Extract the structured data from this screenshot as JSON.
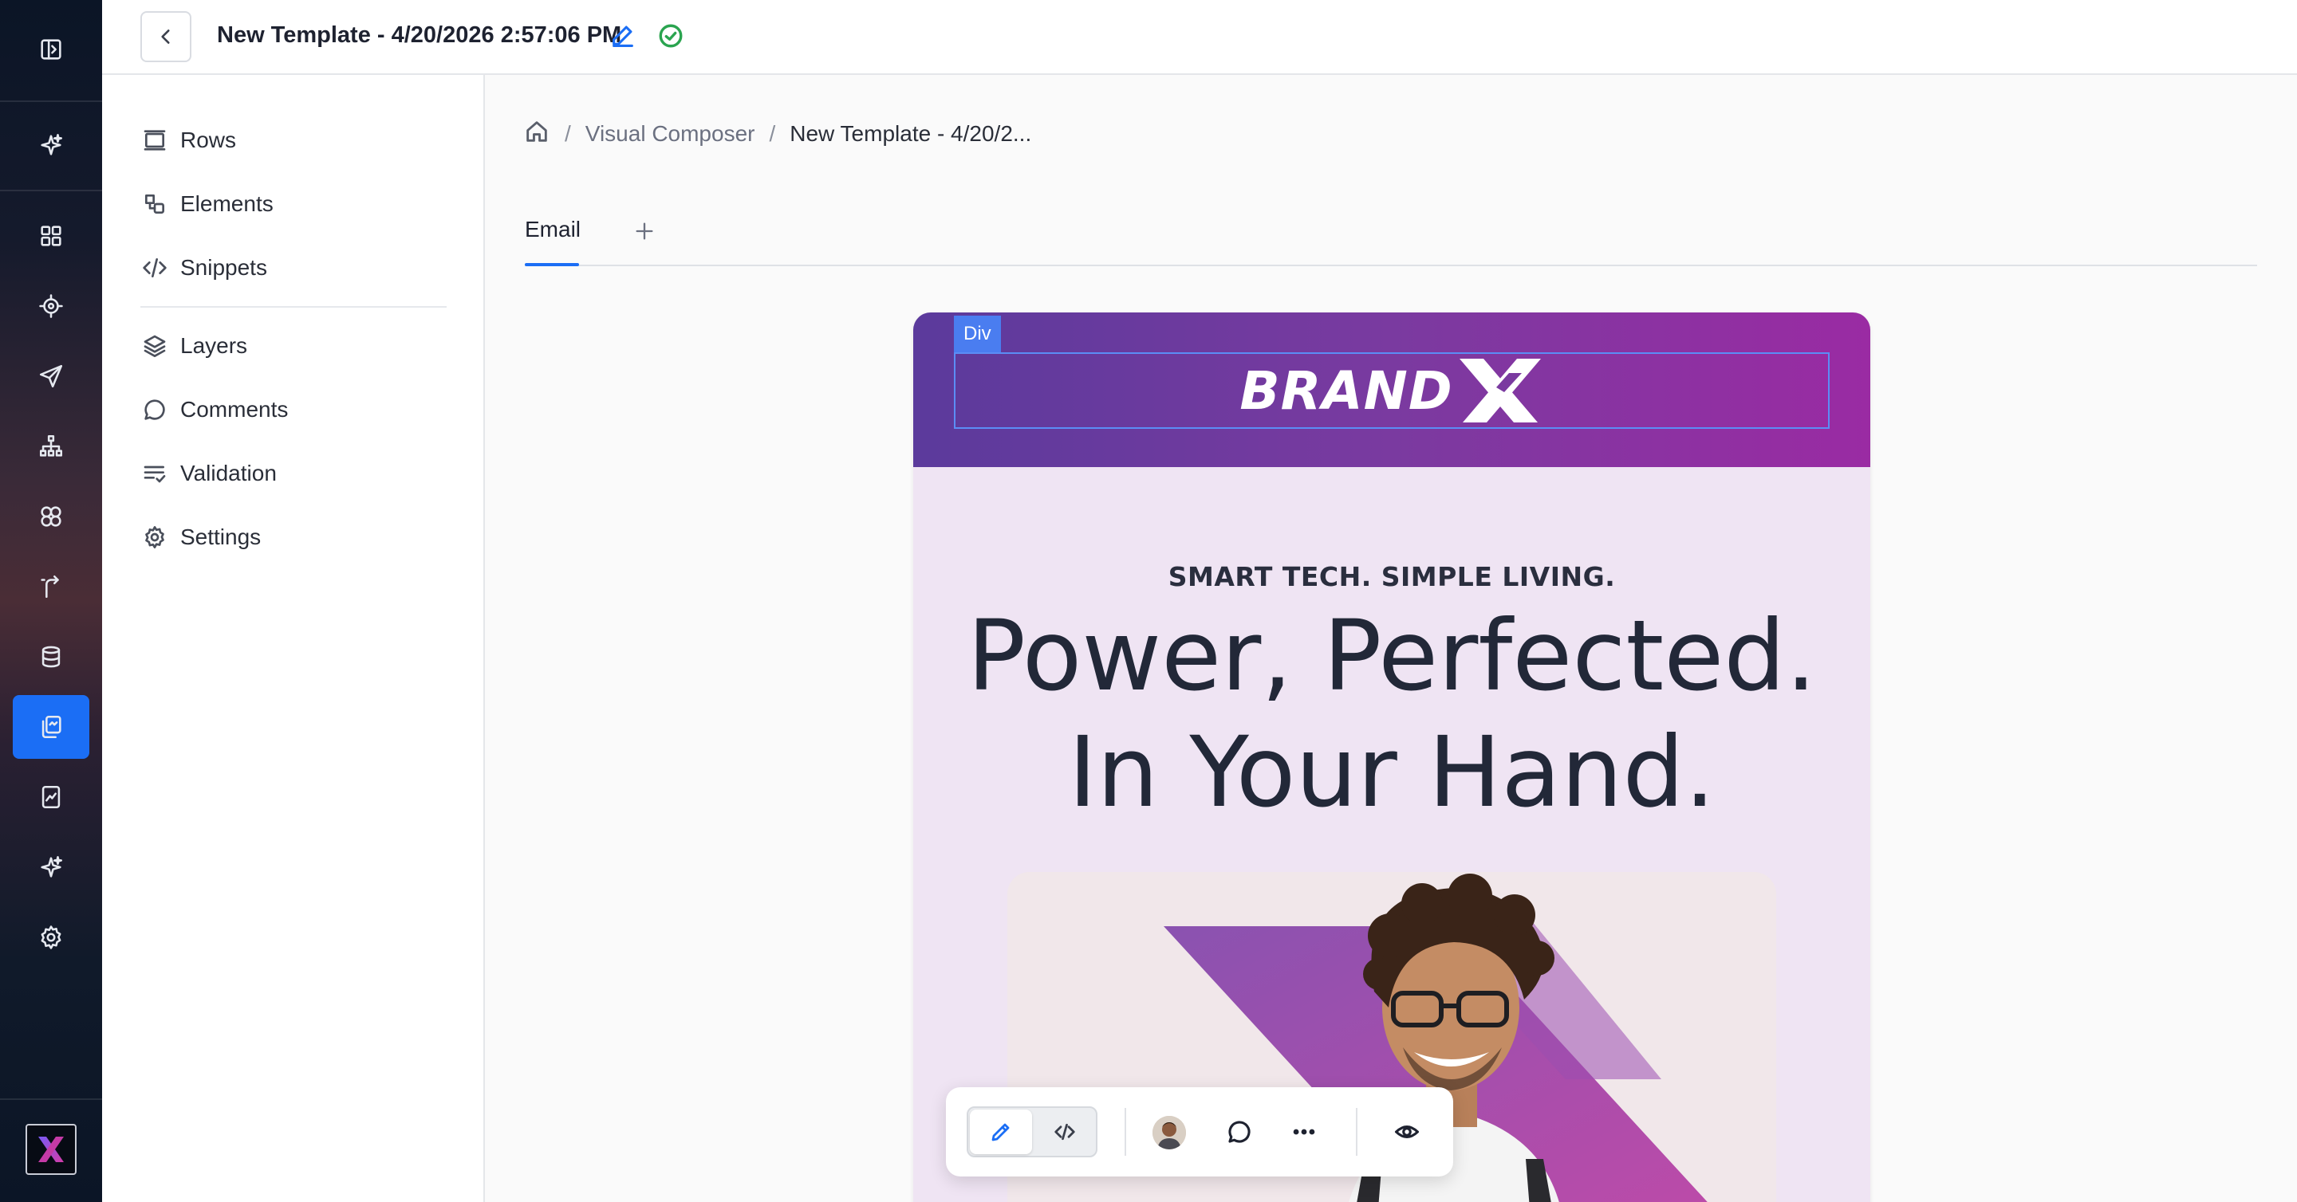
{
  "topbar": {
    "title": "New Template - 4/20/2026 2:57:06 PM"
  },
  "panel": {
    "items": [
      {
        "label": "Rows",
        "icon": "rows-icon"
      },
      {
        "label": "Elements",
        "icon": "elements-icon"
      },
      {
        "label": "Snippets",
        "icon": "code-icon"
      },
      {
        "label": "Layers",
        "icon": "layers-icon"
      },
      {
        "label": "Comments",
        "icon": "comment-icon"
      },
      {
        "label": "Validation",
        "icon": "checklist-icon"
      },
      {
        "label": "Settings",
        "icon": "gear-icon"
      }
    ]
  },
  "breadcrumb": {
    "separator": "/",
    "link": "Visual Composer",
    "current": "New Template - 4/20/2..."
  },
  "tabs": {
    "active": "Email"
  },
  "email": {
    "selection_tag": "Div",
    "brand": "BRAND",
    "eyebrow": "SMART TECH. SIMPLE LIVING.",
    "headline_line1": "Power, Perfected.",
    "headline_line2": "In Your Hand."
  },
  "colors": {
    "accent": "#1b6ef5",
    "saved": "#2aa44f",
    "header_gradient_start": "#5b3a9c",
    "header_gradient_end": "#9a2ba3",
    "email_background": "#efe4f3"
  }
}
